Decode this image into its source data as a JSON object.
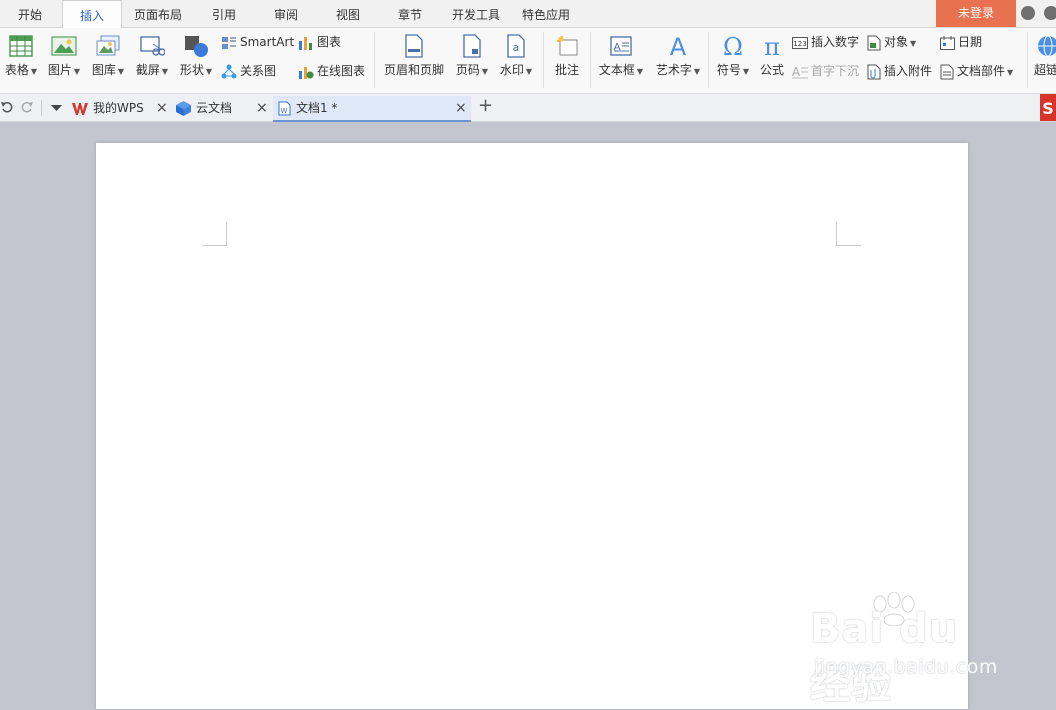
{
  "menu": {
    "tabs": [
      "开始",
      "插入",
      "页面布局",
      "引用",
      "审阅",
      "视图",
      "章节",
      "开发工具",
      "特色应用"
    ],
    "active": "插入",
    "login": "未登录"
  },
  "ribbon": {
    "table": "表格",
    "picture": "图片",
    "gallery": "图库",
    "screenshot": "截屏",
    "shape": "形状",
    "smartart": "SmartArt",
    "chart": "图表",
    "relation": "关系图",
    "online_chart": "在线图表",
    "header_footer": "页眉和页脚",
    "page_number": "页码",
    "watermark": "水印",
    "comment": "批注",
    "textbox": "文本框",
    "wordart": "艺术字",
    "symbol": "符号",
    "formula": "公式",
    "insert_number": "插入数字",
    "drop_cap": "首字下沉",
    "object": "对象",
    "attachment": "插入附件",
    "date": "日期",
    "doc_parts": "文档部件",
    "hyperlink": "超链"
  },
  "doc_tabs": [
    {
      "label": "我的WPS"
    },
    {
      "label": "云文档"
    },
    {
      "label": "文档1 *"
    }
  ],
  "colors": {
    "accent": "#2f63b7",
    "login_bg": "#e8714f",
    "wps_red": "#d9342b"
  },
  "watermark": {
    "main": "Bai du 经验",
    "sub": "jingyan.baidu.com"
  }
}
